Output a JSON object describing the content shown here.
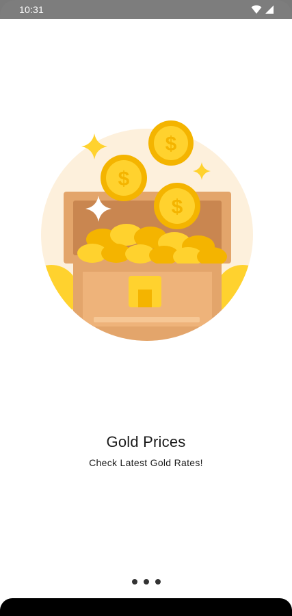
{
  "status_bar": {
    "time": "10:31",
    "icons": [
      "wifi-icon",
      "signal-icon"
    ]
  },
  "splash": {
    "title": "Gold Prices",
    "subtitle": "Check Latest Gold Rates!",
    "illustration": "treasure-chest-with-gold-coins"
  },
  "pager": {
    "dot_count": 3
  },
  "colors": {
    "status_bar": "#7d7d7d",
    "background": "#ffffff",
    "circle_bg": "#fdf0dc",
    "gold": "#ffd22e",
    "gold_dark": "#f4b400",
    "chest": "#e3a56b",
    "chest_dark": "#c98650",
    "nav_bar": "#000000"
  }
}
